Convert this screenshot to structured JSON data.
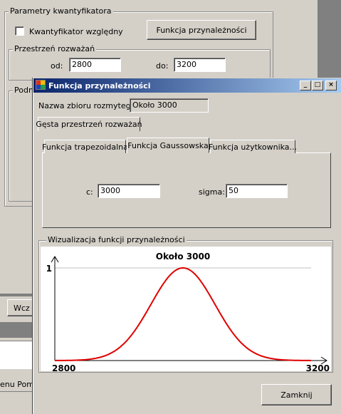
{
  "main": {
    "params_group_title": "Parametry kwantyfikatora",
    "relative_checkbox_label": "Kwantyfikator względny",
    "membership_button_label": "Funkcja przynależności",
    "space_group_title": "Przestrzeń rozważań",
    "from_label": "od:",
    "from_value": "2800",
    "to_label": "do:",
    "to_value": "3200",
    "sub_group_title_partial": "Podm",
    "bottom_button_partial": "Wcz",
    "bottom_text_partial": "enu Pomo"
  },
  "dialog": {
    "title": "Funkcja przynależności",
    "fuzzy_set_name_label": "Nazwa zbioru rozmytego:",
    "fuzzy_set_name_value": "Około 3000",
    "dense_space_tab": "Gęsta przestrzeń rozważań",
    "tabs": [
      "Funkcja trapezoidalna",
      "Funkcja Gaussowska",
      "Funkcja użytkownika..."
    ],
    "active_tab_index": 1,
    "c_label": "c:",
    "c_value": "3000",
    "sigma_label": "sigma:",
    "sigma_value": "50",
    "viz_group_title": "Wizualizacja funkcji przynależności",
    "close_button": "Zamknij"
  },
  "chart_data": {
    "type": "line",
    "title": "Około 3000",
    "function": "gaussian",
    "c": 3000,
    "sigma": 50,
    "xlim": [
      2800,
      3200
    ],
    "ylim": [
      0,
      1
    ],
    "x_tick_labels": [
      "2800",
      "3200"
    ],
    "y_tick_labels": [
      "1"
    ],
    "series_color": "#e00000",
    "x": [
      2800,
      2825,
      2850,
      2875,
      2900,
      2925,
      2950,
      2975,
      3000,
      3025,
      3050,
      3075,
      3100,
      3125,
      3150,
      3175,
      3200
    ],
    "y": [
      0.0003,
      0.0022,
      0.0111,
      0.0439,
      0.1353,
      0.3247,
      0.6065,
      0.8825,
      1.0,
      0.8825,
      0.6065,
      0.3247,
      0.1353,
      0.0439,
      0.0111,
      0.0022,
      0.0003
    ]
  }
}
